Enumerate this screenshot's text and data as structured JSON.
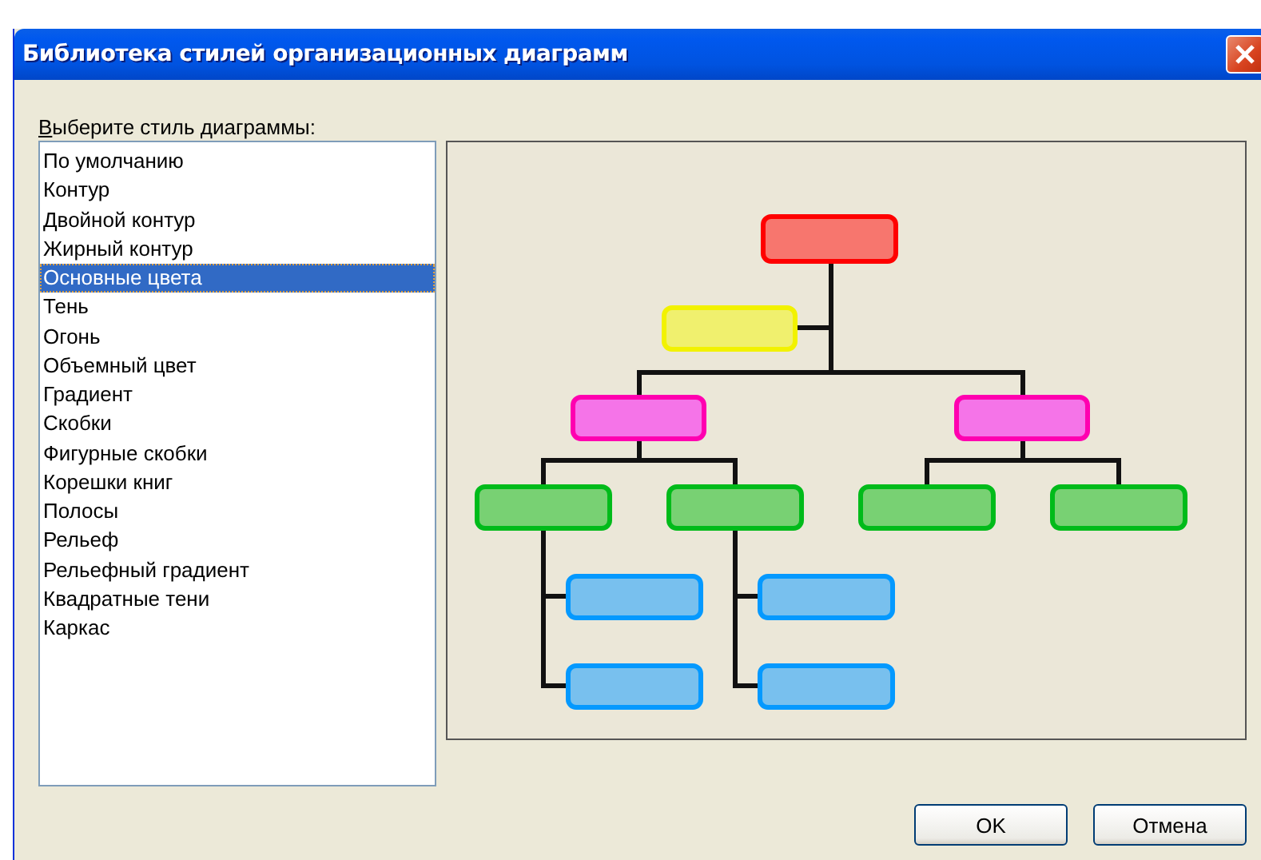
{
  "window": {
    "title": "Библиотека стилей организационных диаграмм"
  },
  "style_list": {
    "label": "Выберите стиль диаграммы:",
    "items": [
      {
        "label": "По умолчанию",
        "selected": false
      },
      {
        "label": "Контур",
        "selected": false
      },
      {
        "label": "Двойной контур",
        "selected": false
      },
      {
        "label": "Жирный контур",
        "selected": false
      },
      {
        "label": "Основные цвета",
        "selected": true
      },
      {
        "label": "Тень",
        "selected": false
      },
      {
        "label": "Огонь",
        "selected": false
      },
      {
        "label": "Объемный цвет",
        "selected": false
      },
      {
        "label": "Градиент",
        "selected": false
      },
      {
        "label": "Скобки",
        "selected": false
      },
      {
        "label": "Фигурные скобки",
        "selected": false
      },
      {
        "label": "Корешки книг",
        "selected": false
      },
      {
        "label": "Полосы",
        "selected": false
      },
      {
        "label": "Рельеф",
        "selected": false
      },
      {
        "label": "Рельефный градиент",
        "selected": false
      },
      {
        "label": "Квадратные тени",
        "selected": false
      },
      {
        "label": "Каркас",
        "selected": false
      }
    ]
  },
  "buttons": [
    "OK",
    "Отмена"
  ]
}
